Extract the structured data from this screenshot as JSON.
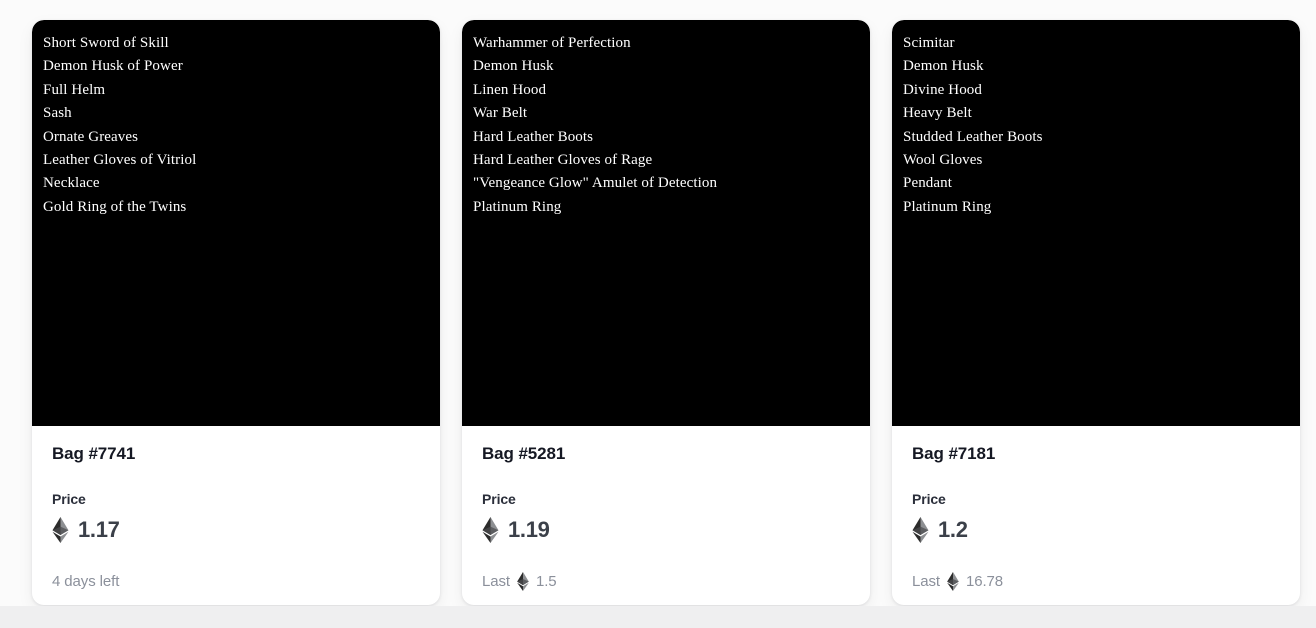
{
  "page": {
    "background_color": "#fbfbfb",
    "card_background_color": "#ffffff",
    "art_background_color": "#000000",
    "muted_text_color": "#8b909b",
    "title_text_color": "#151823"
  },
  "icons": {
    "eth": "ethereum-diamond-icon"
  },
  "labels": {
    "price": "Price",
    "last": "Last"
  },
  "cards": [
    {
      "title": "Bag #7741",
      "price_label": "Price",
      "price_value": "1.17",
      "footer_prefix": "",
      "footer_has_eth_icon": false,
      "footer_text": "4 days left",
      "items": [
        "Short Sword of Skill",
        "Demon Husk of Power",
        "Full Helm",
        "Sash",
        "Ornate Greaves",
        "Leather Gloves of Vitriol",
        "Necklace",
        "Gold Ring of the Twins"
      ]
    },
    {
      "title": "Bag #5281",
      "price_label": "Price",
      "price_value": "1.19",
      "footer_prefix": "Last",
      "footer_has_eth_icon": true,
      "footer_text": "1.5",
      "items": [
        "Warhammer of Perfection",
        "Demon Husk",
        "Linen Hood",
        "War Belt",
        "Hard Leather Boots",
        "Hard Leather Gloves of Rage",
        "\"Vengeance Glow\" Amulet of Detection",
        "Platinum Ring"
      ]
    },
    {
      "title": "Bag #7181",
      "price_label": "Price",
      "price_value": "1.2",
      "footer_prefix": "Last",
      "footer_has_eth_icon": true,
      "footer_text": "16.78",
      "items": [
        "Scimitar",
        "Demon Husk",
        "Divine Hood",
        "Heavy Belt",
        "Studded Leather Boots",
        "Wool Gloves",
        "Pendant",
        "Platinum Ring"
      ]
    }
  ]
}
